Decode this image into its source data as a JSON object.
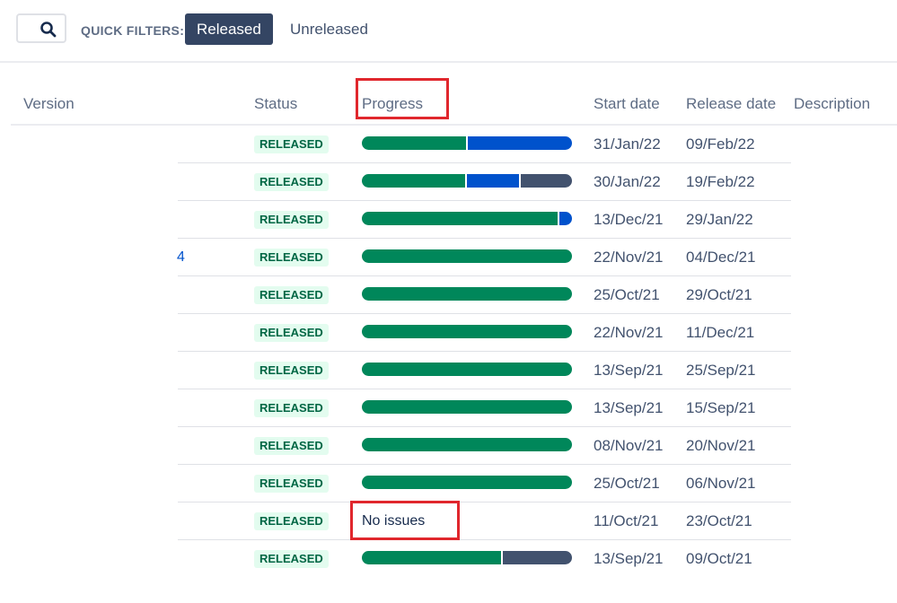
{
  "filters": {
    "label": "QUICK FILTERS:",
    "released_label": "Released",
    "unreleased_label": "Unreleased"
  },
  "columns": {
    "version": "Version",
    "status": "Status",
    "progress": "Progress",
    "start_date": "Start date",
    "release_date": "Release date",
    "description": "Description"
  },
  "colors": {
    "done": "#00875a",
    "in_progress": "#0052cc",
    "todo": "#42526e",
    "highlight": "#e0272d"
  },
  "rows": [
    {
      "version": "",
      "status": "RELEASED",
      "progress": [
        0.5,
        0.5,
        0
      ],
      "no_issues": "",
      "start_date": "31/Jan/22",
      "release_date": "09/Feb/22"
    },
    {
      "version": "",
      "status": "RELEASED",
      "progress": [
        0.5,
        0.25,
        0.25
      ],
      "no_issues": "",
      "start_date": "30/Jan/22",
      "release_date": "19/Feb/22"
    },
    {
      "version": "",
      "status": "RELEASED",
      "progress": [
        0.94,
        0.06,
        0
      ],
      "no_issues": "",
      "start_date": "13/Dec/21",
      "release_date": "29/Jan/22"
    },
    {
      "version": "4",
      "status": "RELEASED",
      "progress": [
        1,
        0,
        0
      ],
      "no_issues": "",
      "start_date": "22/Nov/21",
      "release_date": "04/Dec/21"
    },
    {
      "version": "",
      "status": "RELEASED",
      "progress": [
        1,
        0,
        0
      ],
      "no_issues": "",
      "start_date": "25/Oct/21",
      "release_date": "29/Oct/21"
    },
    {
      "version": "",
      "status": "RELEASED",
      "progress": [
        1,
        0,
        0
      ],
      "no_issues": "",
      "start_date": "22/Nov/21",
      "release_date": "11/Dec/21"
    },
    {
      "version": "",
      "status": "RELEASED",
      "progress": [
        1,
        0,
        0
      ],
      "no_issues": "",
      "start_date": "13/Sep/21",
      "release_date": "25/Sep/21"
    },
    {
      "version": "",
      "status": "RELEASED",
      "progress": [
        1,
        0,
        0
      ],
      "no_issues": "",
      "start_date": "13/Sep/21",
      "release_date": "15/Sep/21"
    },
    {
      "version": "",
      "status": "RELEASED",
      "progress": [
        1,
        0,
        0
      ],
      "no_issues": "",
      "start_date": "08/Nov/21",
      "release_date": "20/Nov/21"
    },
    {
      "version": "",
      "status": "RELEASED",
      "progress": [
        1,
        0,
        0
      ],
      "no_issues": "",
      "start_date": "25/Oct/21",
      "release_date": "06/Nov/21"
    },
    {
      "version": "",
      "status": "RELEASED",
      "progress": null,
      "no_issues": "No issues",
      "start_date": "11/Oct/21",
      "release_date": "23/Oct/21"
    },
    {
      "version": "",
      "status": "RELEASED",
      "progress": [
        0.67,
        0,
        0.33
      ],
      "no_issues": "",
      "start_date": "13/Sep/21",
      "release_date": "09/Oct/21"
    }
  ]
}
